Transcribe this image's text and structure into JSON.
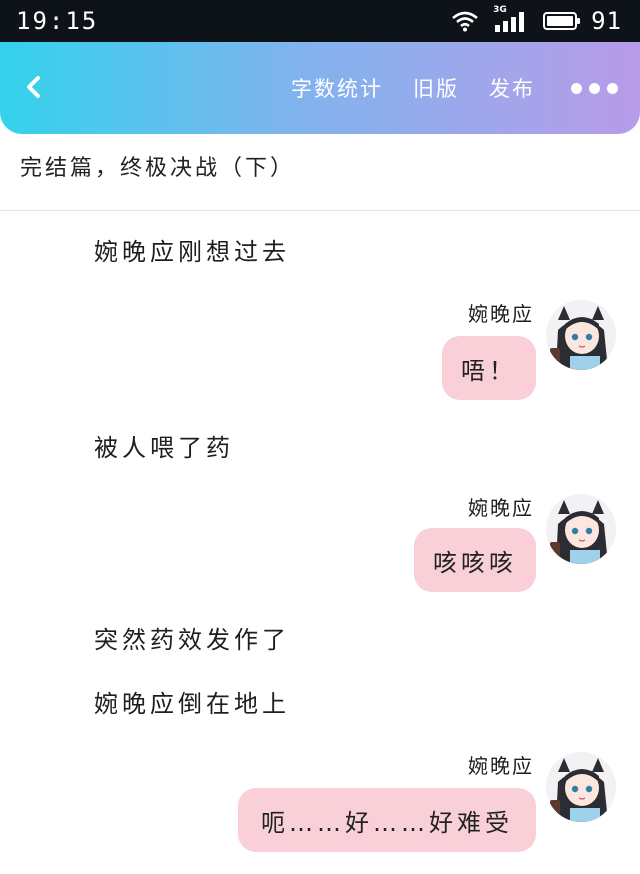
{
  "status_bar": {
    "time": "19:15",
    "network": "3G",
    "battery": "91"
  },
  "header": {
    "back_icon": "chevron-left-icon",
    "actions": [
      "字数统计",
      "旧版",
      "发布"
    ],
    "more_icon": "more-dots-icon"
  },
  "chapter": {
    "title": "完结篇，终极决战（下）"
  },
  "story": {
    "narration": [
      "婉晚应刚想过去",
      "被人喂了药",
      "突然药效发作了",
      "婉晚应倒在地上"
    ],
    "dialogues": [
      {
        "speaker": "婉晚应",
        "text": "唔！"
      },
      {
        "speaker": "婉晚应",
        "text": "咳咳咳"
      },
      {
        "speaker": "婉晚应",
        "text": "呃……好……好难受"
      }
    ]
  },
  "colors": {
    "header_gradient_start": "#33d2ec",
    "header_gradient_end": "#b89be8",
    "bubble": "#fad0d8",
    "status_bar": "#0d1318"
  }
}
